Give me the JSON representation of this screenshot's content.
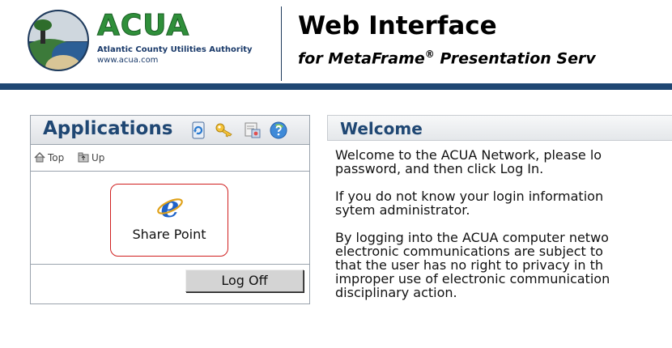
{
  "header": {
    "logo_text": "ACUA",
    "logo_org": "Atlantic County Utilities Authority",
    "logo_url": "www.acua.com",
    "title": "Web Interface",
    "subtitle": "for MetaFrame",
    "subtitle_mark": "®",
    "subtitle_rest": " Presentation Serv"
  },
  "applications": {
    "title": "Applications",
    "toolbar_icons": [
      "refresh-icon",
      "key-icon",
      "settings-icon",
      "help-icon"
    ],
    "nav": {
      "top": "Top",
      "up": "Up"
    },
    "apps": [
      {
        "label": "Share Point",
        "icon": "internet-explorer-icon"
      }
    ],
    "logoff_label": "Log Off"
  },
  "welcome": {
    "title": "Welcome",
    "paragraphs": [
      [
        "Welcome to the ACUA Network, please lo",
        "password, and then click Log In."
      ],
      [
        "If you do not know your login information",
        "sytem administrator."
      ],
      [
        "By logging into the ACUA computer netwo",
        "electronic communications are subject to",
        "that the user has no right to privacy in th",
        "improper use of electronic communication",
        "disciplinary action."
      ]
    ]
  },
  "colors": {
    "brand_navy": "#1f4773",
    "logo_green": "#2f8f3a",
    "tile_border": "#d02020"
  }
}
